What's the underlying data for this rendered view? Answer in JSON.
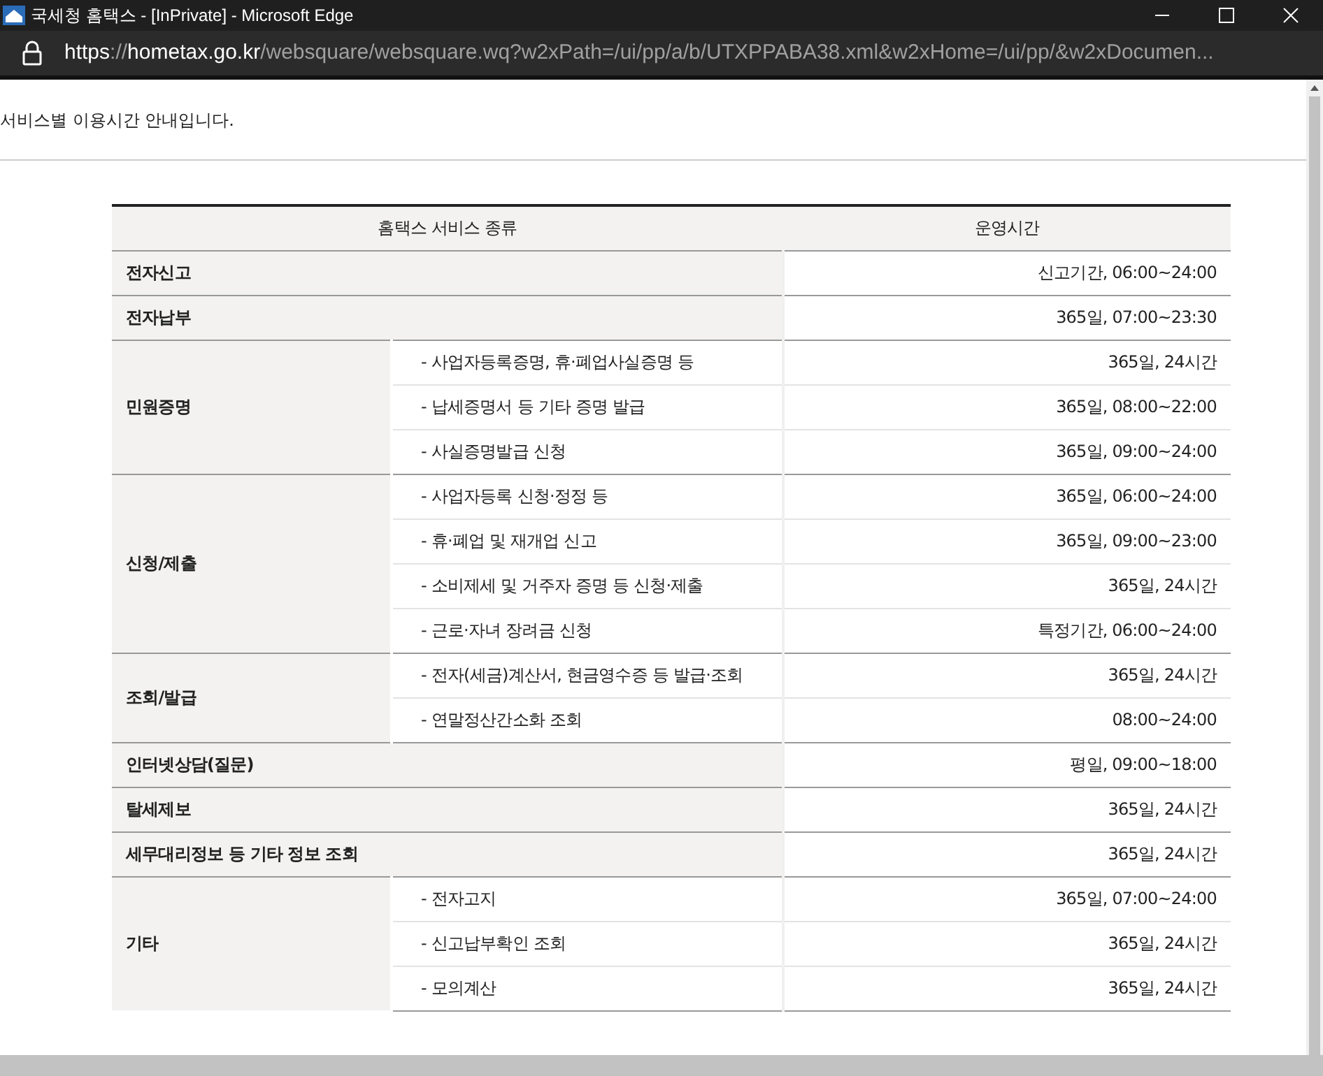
{
  "window": {
    "title": "국세청 홈택스 - [InPrivate] - Microsoft Edge"
  },
  "address_bar": {
    "scheme": "https",
    "separator": "://",
    "host": "hometax.go.kr",
    "path": "/websquare/websquare.wq?w2xPath=/ui/pp/a/b/UTXPPABA38.xml&w2xHome=/ui/pp/&w2xDocumen..."
  },
  "intro": "서비스별 이용시간 안내입니다.",
  "table": {
    "columns": [
      "홈택스 서비스 종류",
      "운영시간"
    ],
    "rows": [
      {
        "kind": "single",
        "service": "전자신고",
        "hours": "신고기간, 06:00~24:00"
      },
      {
        "kind": "single",
        "service": "전자납부",
        "hours": "365일, 07:00~23:30"
      },
      {
        "kind": "group",
        "service": "민원증명",
        "items": [
          {
            "name": "- 사업자등록증명, 휴·폐업사실증명 등",
            "hours": "365일, 24시간"
          },
          {
            "name": "- 납세증명서 등 기타 증명 발급",
            "hours": "365일, 08:00~22:00"
          },
          {
            "name": "- 사실증명발급 신청",
            "hours": "365일, 09:00~24:00"
          }
        ]
      },
      {
        "kind": "group",
        "service": "신청/제출",
        "items": [
          {
            "name": "- 사업자등록 신청·정정 등",
            "hours": "365일, 06:00~24:00"
          },
          {
            "name": "- 휴·폐업 및 재개업 신고",
            "hours": "365일, 09:00~23:00"
          },
          {
            "name": "- 소비제세 및 거주자 증명 등 신청·제출",
            "hours": "365일, 24시간"
          },
          {
            "name": "- 근로·자녀 장려금 신청",
            "hours": "특정기간, 06:00~24:00"
          }
        ]
      },
      {
        "kind": "group",
        "service": "조회/발급",
        "items": [
          {
            "name": "- 전자(세금)계산서, 현금영수증 등 발급·조회",
            "hours": "365일, 24시간"
          },
          {
            "name": "- 연말정산간소화 조회",
            "hours": "08:00~24:00"
          }
        ]
      },
      {
        "kind": "single",
        "service": "인터넷상담(질문)",
        "hours": "평일, 09:00~18:00"
      },
      {
        "kind": "single",
        "service": "탈세제보",
        "hours": "365일, 24시간"
      },
      {
        "kind": "single",
        "service": "세무대리정보 등 기타 정보 조회",
        "hours": "365일, 24시간"
      },
      {
        "kind": "group",
        "service": "기타",
        "items": [
          {
            "name": "- 전자고지",
            "hours": "365일, 07:00~24:00"
          },
          {
            "name": "- 신고납부확인 조회",
            "hours": "365일, 24시간"
          },
          {
            "name": "- 모의계산",
            "hours": "365일, 24시간"
          }
        ]
      }
    ]
  }
}
